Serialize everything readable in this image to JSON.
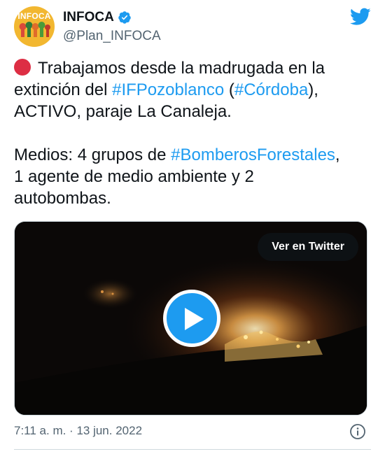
{
  "author": {
    "display_name": "INFOCA",
    "handle": "@Plan_INFOCA",
    "avatar_label": "INFOCA",
    "verified": true
  },
  "tweet": {
    "line1_text": "Trabajamos desde la madrugada en la",
    "line2_prefix": "extinción del ",
    "line2_hashtag1": "#IFPozoblanco",
    "line2_mid": " (",
    "line2_hashtag2": "#Córdoba",
    "line2_suffix": "),",
    "line3_text": "ACTIVO, paraje La Canaleja.",
    "line4_prefix": "Medios: 4 grupos de ",
    "line4_hashtag": "#BomberosForestales",
    "line4_suffix": ",",
    "line5_text": "1 agente de medio ambiente y 2",
    "line6_text": "autobombas."
  },
  "media": {
    "view_button_label": "Ver en Twitter",
    "play_icon": "play-icon"
  },
  "footer": {
    "timestamp": "7:11 a. m. · 13 jun. 2022",
    "info_icon": "info-icon"
  },
  "colors": {
    "link": "#1d9bf0",
    "text": "#0f1419",
    "secondary": "#536471",
    "red_circle": "#dd2e44",
    "avatar": "#f2b730"
  }
}
